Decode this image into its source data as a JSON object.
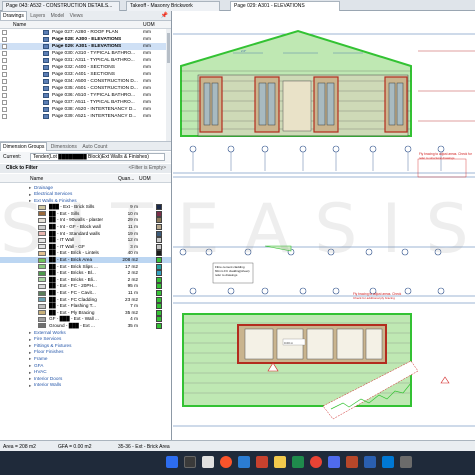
{
  "doc_tabs": [
    {
      "label": "Page 043: A532 - CONSTRUCTION DETAILS...",
      "active": false
    },
    {
      "label": "Takeoff - Masonry Brickwork",
      "active": false
    },
    {
      "label": "Page 029: A301 - ELEVATIONS",
      "active": true
    }
  ],
  "left_tabs": [
    "Drawings",
    "Layers",
    "Model",
    "Views"
  ],
  "drawings_header": {
    "name": "Name",
    "uom": "UOM"
  },
  "drawings": [
    {
      "name": "Page 027: A280 - ROOF PLAN",
      "uom": "mm",
      "bold": false,
      "selected": false
    },
    {
      "name": "Page 028: A300 - ELEVATIONS",
      "uom": "mm",
      "bold": true,
      "selected": false
    },
    {
      "name": "Page 029: A301 - ELEVATIONS",
      "uom": "mm",
      "bold": true,
      "selected": true
    },
    {
      "name": "Page 030: A310 - TYPICAL BATHRO...",
      "uom": "mm",
      "bold": false,
      "selected": false
    },
    {
      "name": "Page 031: A311 - TYPICAL BATHRO...",
      "uom": "mm",
      "bold": false,
      "selected": false
    },
    {
      "name": "Page 032: A400 - SECTIONS",
      "uom": "mm",
      "bold": false,
      "selected": false
    },
    {
      "name": "Page 033: A401 - SECTIONS",
      "uom": "mm",
      "bold": false,
      "selected": false
    },
    {
      "name": "Page 034: A500 - CONSTRUCTION D...",
      "uom": "mm",
      "bold": false,
      "selected": false
    },
    {
      "name": "Page 035: A501 - CONSTRUCTION D...",
      "uom": "mm",
      "bold": false,
      "selected": false
    },
    {
      "name": "Page 036: A510 - TYPICAL BATHRO...",
      "uom": "mm",
      "bold": false,
      "selected": false
    },
    {
      "name": "Page 037: A511 - TYPICAL BATHRO...",
      "uom": "mm",
      "bold": false,
      "selected": false
    },
    {
      "name": "Page 038: A520 - INTERTENANCY D...",
      "uom": "mm",
      "bold": false,
      "selected": false
    },
    {
      "name": "Page 039: A521 - INTERTENANCY D...",
      "uom": "mm",
      "bold": false,
      "selected": false
    }
  ],
  "dim_tabs": [
    "Dimension Groups",
    "Dimensions",
    "Auto Count"
  ],
  "current": {
    "label": "Current:",
    "value": "Tender(Lot ████████ Block)Ext Walls & Finishes)"
  },
  "filter": {
    "click": "Click to Filter",
    "empty": "<Filter is Empty>"
  },
  "group_header": {
    "name": "Name",
    "qty": "Quan...",
    "uom": "UOM"
  },
  "tree": [
    {
      "indent": 1,
      "label": "Drainage",
      "folder": true
    },
    {
      "indent": 1,
      "label": "Electrical Services",
      "folder": true
    },
    {
      "indent": 1,
      "label": "Ext Walls & Finishes",
      "folder": true
    },
    {
      "indent": 2,
      "label": "███ - Ext - Brick Sills",
      "qty": "9 m",
      "swatch": "#cfc7a0",
      "cb": "#1c2a4a"
    },
    {
      "indent": 2,
      "label": "██ - Ext - Sills",
      "qty": "10 m",
      "swatch": "#9a6a3c",
      "cb": "#7c2f4a"
    },
    {
      "indent": 2,
      "label": "██ - Int - 90walls - plaster",
      "qty": "29 m",
      "swatch": "#e5e1d7",
      "cb": "#8c7a5a"
    },
    {
      "indent": 2,
      "label": "██ - Int - GF - Block wall",
      "qty": "11 m",
      "swatch": "#cfcfcf",
      "cb": "#b8a88c"
    },
    {
      "indent": 2,
      "label": "██ - Int - Standard walls",
      "qty": "19 m",
      "swatch": "#e8b5b0",
      "cb": "#3c5b7a"
    },
    {
      "indent": 2,
      "label": "██ - IT Wall",
      "qty": "12 m",
      "swatch": "#e3e3e3",
      "cb": "#c7c7c7"
    },
    {
      "indent": 2,
      "label": "██ - IT Wall - GF",
      "qty": "3 m",
      "swatch": "#e3e3e3",
      "cb": "#c7c7c7"
    },
    {
      "indent": 2,
      "label": "██ - Ext - Brick - Lintels",
      "qty": "40 m",
      "swatch": "#e2c090",
      "cb": "#1a1a1a"
    },
    {
      "indent": 2,
      "label": "██ - Ext - Brick Area",
      "qty": "208 m2",
      "swatch": "#6cc25a",
      "cb": "#36c236",
      "highlight": true
    },
    {
      "indent": 2,
      "label": "██ - Ext - Brick Slips ...",
      "qty": "17 m2",
      "swatch": "#8ac97f",
      "cb": "#25a1a1"
    },
    {
      "indent": 2,
      "label": "██ - Ext - Bricks - Bl...",
      "qty": "2 m2",
      "swatch": "#4c9a4c",
      "cb": "#34a0c0"
    },
    {
      "indent": 2,
      "label": "██ - Ext - Bricks - Bli...",
      "qty": "2 m2",
      "swatch": "#a7d3a0",
      "cb": "#36c236"
    },
    {
      "indent": 2,
      "label": "██ - Ext - FC - 20PH...",
      "qty": "95 m",
      "swatch": "#dadada",
      "cb": "#36c236"
    },
    {
      "indent": 2,
      "label": "██ - Ext - FC - Cavit...",
      "qty": "11 m",
      "swatch": "#5a7e5a",
      "cb": "#36c236"
    },
    {
      "indent": 2,
      "label": "██ - Ext - FC Cladding",
      "qty": "23 m2",
      "swatch": "#6aa0b0",
      "cb": "#36c236"
    },
    {
      "indent": 2,
      "label": "██ - Ext - Flashing T...",
      "qty": "7 m",
      "swatch": "#c0c0c0",
      "cb": "#36c236"
    },
    {
      "indent": 2,
      "label": "██ - Ext - Ply Bracing",
      "qty": "35 m2",
      "swatch": "#c7b07a",
      "cb": "#36c236"
    },
    {
      "indent": 2,
      "label": "GF - ███ - Ext - Wall ...",
      "qty": "4 m",
      "swatch": "#a0a0a0",
      "cb": "#36c236"
    },
    {
      "indent": 2,
      "label": "Ground - ███ - Ext ...",
      "qty": "35 m",
      "swatch": "#707070",
      "cb": "#36c236"
    },
    {
      "indent": 1,
      "label": "External Works",
      "folder": true
    },
    {
      "indent": 1,
      "label": "Fire Services",
      "folder": true
    },
    {
      "indent": 1,
      "label": "Fittings & Fixtures",
      "folder": true
    },
    {
      "indent": 1,
      "label": "Floor Finishes",
      "folder": true
    },
    {
      "indent": 1,
      "label": "Frame",
      "folder": true
    },
    {
      "indent": 1,
      "label": "GFA",
      "folder": true
    },
    {
      "indent": 1,
      "label": "HVAC",
      "folder": true
    },
    {
      "indent": 1,
      "label": "Interior Doors",
      "folder": true
    },
    {
      "indent": 1,
      "label": "Interior Walls",
      "folder": true
    }
  ],
  "status": {
    "area": "Area = 208 m2",
    "gfa": "GFA = 0.00 m2",
    "item": "35-36 - Ext - Brick Area"
  },
  "canvas": {
    "note1": "Fly bracing to adjust areas. Check for additional ply bracing(eg. heavy panel) refer to structural drawings",
    "note2": "Fly bracing to adjust areas. Check for additional ply bracing(eg. heavy panel) refer to structural",
    "tag1": "Fibre cement cladding 60mm FC cladding(sheet) refer to drawings",
    "tag2": "Ply bracing to adjust areas.",
    "tag3": "Fly bracing to adjust areas. Check for additional..."
  },
  "watermark": "SITEASIS"
}
